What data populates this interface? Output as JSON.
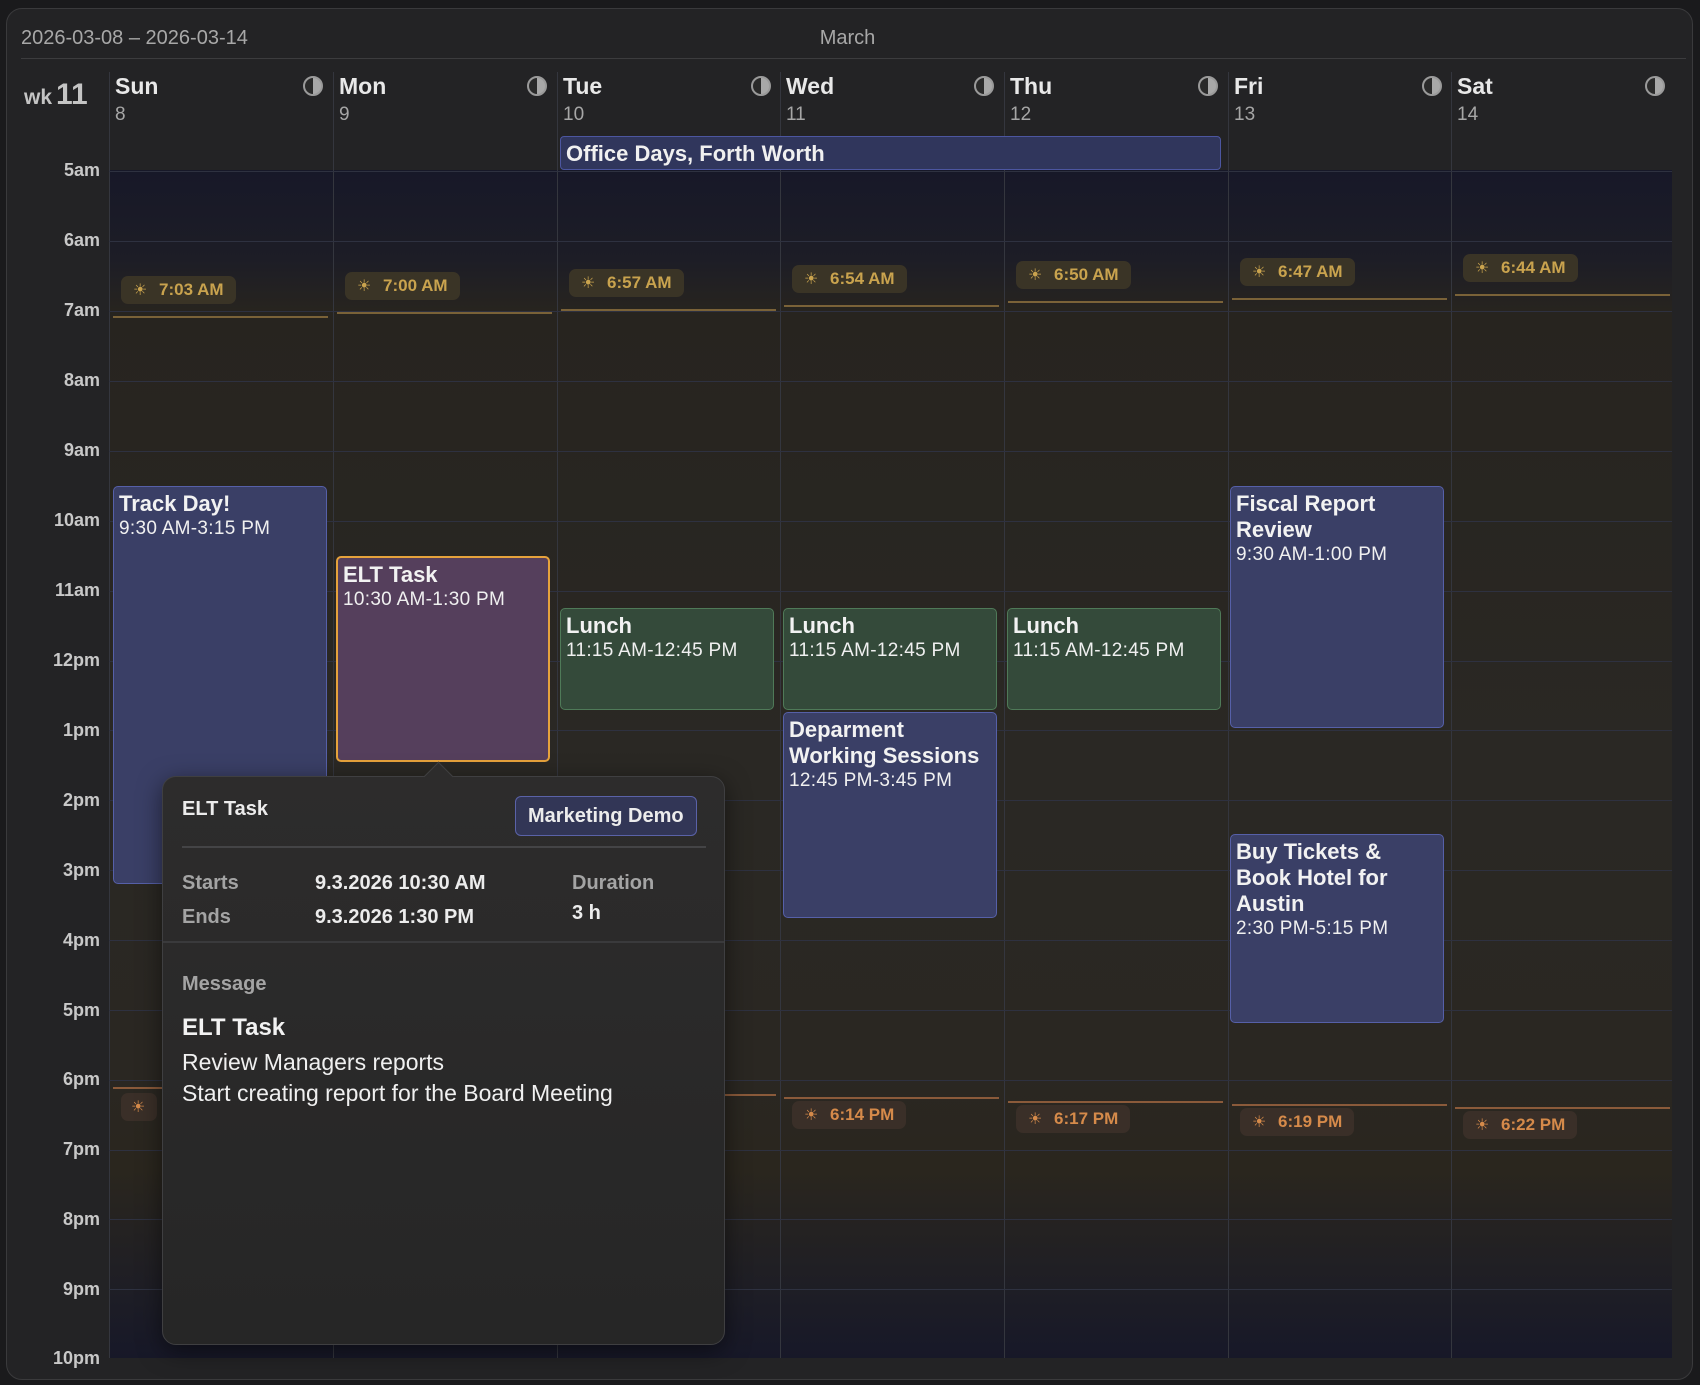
{
  "header": {
    "range": "2026-03-08 – 2026-03-14",
    "month": "March",
    "week_label": "wk",
    "week_number": "11"
  },
  "days": [
    {
      "name": "Sun",
      "date": "8"
    },
    {
      "name": "Mon",
      "date": "9"
    },
    {
      "name": "Tue",
      "date": "10"
    },
    {
      "name": "Wed",
      "date": "11"
    },
    {
      "name": "Thu",
      "date": "12"
    },
    {
      "name": "Fri",
      "date": "13"
    },
    {
      "name": "Sat",
      "date": "14"
    }
  ],
  "hours": [
    "5am",
    "6am",
    "7am",
    "8am",
    "9am",
    "10am",
    "11am",
    "12pm",
    "1pm",
    "2pm",
    "3pm",
    "4pm",
    "5pm",
    "6pm",
    "7pm",
    "8pm",
    "9pm",
    "10pm"
  ],
  "all_day": {
    "title": "Office Days, Forth Worth"
  },
  "sunrise": [
    "7:03 AM",
    "7:00 AM",
    "6:57 AM",
    "6:54 AM",
    "6:50 AM",
    "6:47 AM",
    "6:44 AM"
  ],
  "sunset": [
    "6:14 PM",
    "6:17 PM",
    "6:19 PM",
    "6:22 PM"
  ],
  "events": {
    "track_day": {
      "title": "Track Day!",
      "time": "9:30 AM-3:15 PM"
    },
    "elt_task": {
      "title": "ELT Task",
      "time": "10:30 AM-1:30 PM"
    },
    "lunch_tue": {
      "title": "Lunch",
      "time": "11:15 AM-12:45 PM"
    },
    "lunch_wed": {
      "title": "Lunch",
      "time": "11:15 AM-12:45 PM"
    },
    "lunch_thu": {
      "title": "Lunch",
      "time": "11:15 AM-12:45 PM"
    },
    "dept": {
      "title": "Deparment Working Sessions",
      "time": "12:45 PM-3:45 PM"
    },
    "fiscal": {
      "title": "Fiscal Report Review",
      "time": "9:30 AM-1:00 PM"
    },
    "tickets": {
      "title": "Buy Tickets & Book Hotel for Austin",
      "time": "2:30 PM-5:15 PM"
    }
  },
  "popover": {
    "title": "ELT Task",
    "calendar": "Marketing Demo",
    "starts_label": "Starts",
    "starts_value": "9.3.2026 10:30 AM",
    "ends_label": "Ends",
    "ends_value": "9.3.2026 1:30 PM",
    "duration_label": "Duration",
    "duration_value": "3 h",
    "message_label": "Message",
    "message_title": "ELT Task",
    "message_body": "Review Managers reports\nStart creating report for the Board Meeting"
  },
  "colors": {
    "calendar_blue": "#3a3f66",
    "lunch_green": "#344a3a",
    "selected_border": "#e6a23c",
    "sunrise_text": "#c9a34e",
    "sunset_text": "#d58a4a"
  }
}
